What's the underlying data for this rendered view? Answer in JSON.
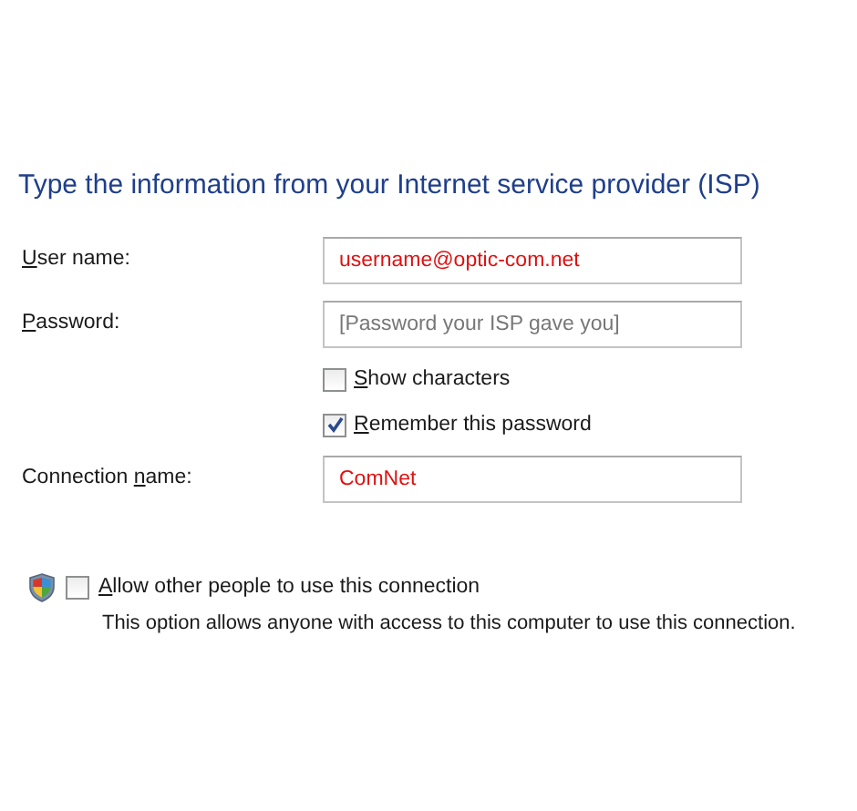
{
  "heading": "Type the information from your Internet service provider (ISP)",
  "fields": [
    {
      "kind": "field",
      "label": [
        {
          "text": "U",
          "underlined": true
        },
        {
          "text": "ser name:",
          "underlined": false
        }
      ],
      "value": "username@optic-com.net"
    },
    {
      "kind": "field",
      "label": [
        {
          "text": "P",
          "underlined": true
        },
        {
          "text": "assword:",
          "underlined": false
        }
      ],
      "placeholder": "[Password your ISP gave you]"
    },
    {
      "kind": "checkbox",
      "label": [
        {
          "text": "S",
          "underlined": true
        },
        {
          "text": "how characters",
          "underlined": false
        }
      ],
      "checked": false
    },
    {
      "kind": "checkbox",
      "label": [
        {
          "text": "R",
          "underlined": true
        },
        {
          "text": "emember this password",
          "underlined": false
        }
      ],
      "checked": true
    },
    {
      "kind": "field",
      "label": [
        {
          "text": "Connection ",
          "underlined": false
        },
        {
          "text": "n",
          "underlined": true
        },
        {
          "text": "ame:",
          "underlined": false
        }
      ],
      "value": "ComNet"
    }
  ],
  "sharing": {
    "label": [
      {
        "text": "A",
        "underlined": true
      },
      {
        "text": "llow other people to use this connection",
        "underlined": false
      }
    ],
    "checked": false,
    "description": "This option allows anyone with access to this computer to use this connection."
  }
}
